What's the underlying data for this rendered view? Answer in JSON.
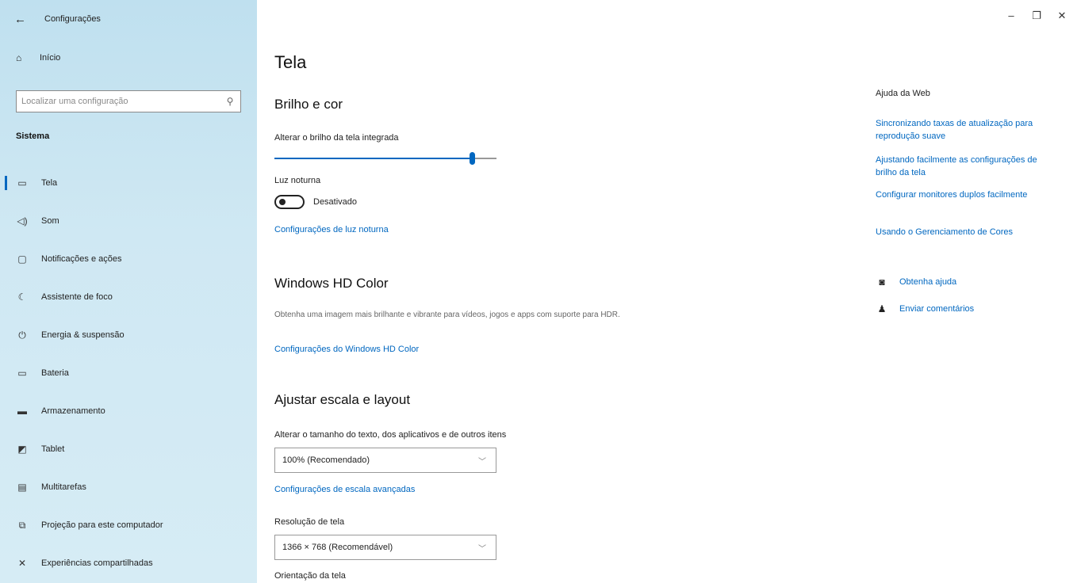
{
  "window": {
    "app_title": "Configurações",
    "back_icon": "back-arrow-icon",
    "controls": {
      "minimize": "–",
      "restore": "❐",
      "close": "✕"
    }
  },
  "sidebar": {
    "home_label": "Início",
    "search_placeholder": "Localizar uma configuração",
    "section": "Sistema",
    "items": [
      {
        "label": "Tela",
        "icon": "monitor-icon",
        "selected": true
      },
      {
        "label": "Som",
        "icon": "speaker-icon",
        "selected": false
      },
      {
        "label": "Notificações e ações",
        "icon": "notification-icon",
        "selected": false
      },
      {
        "label": "Assistente de foco",
        "icon": "moon-icon",
        "selected": false
      },
      {
        "label": "Energia & suspensão",
        "icon": "power-icon",
        "selected": false
      },
      {
        "label": "Bateria",
        "icon": "battery-icon",
        "selected": false
      },
      {
        "label": "Armazenamento",
        "icon": "storage-icon",
        "selected": false
      },
      {
        "label": "Tablet",
        "icon": "tablet-icon",
        "selected": false
      },
      {
        "label": "Multitarefas",
        "icon": "multitasking-icon",
        "selected": false
      },
      {
        "label": "Projeção para este computador",
        "icon": "projection-icon",
        "selected": false
      },
      {
        "label": "Experiências compartilhadas",
        "icon": "shared-icon",
        "selected": false
      }
    ]
  },
  "main": {
    "title": "Tela",
    "brightness": {
      "heading": "Brilho e cor",
      "slider_label": "Alterar o brilho da tela integrada",
      "value_fraction": 0.89,
      "night_light_label": "Luz noturna",
      "night_light_state": "Desativado",
      "night_light_link": "Configurações de luz noturna"
    },
    "hdr": {
      "heading": "Windows HD Color",
      "description": "Obtenha uma imagem mais brilhante e vibrante para vídeos, jogos e apps com suporte para HDR.",
      "link": "Configurações do Windows HD Color"
    },
    "scale": {
      "heading": "Ajustar escala e layout",
      "size_label": "Alterar o tamanho do texto, dos aplicativos e de outros itens",
      "size_value": "100% (Recomendado)",
      "advanced_link": "Configurações de escala avançadas",
      "resolution_label": "Resolução de tela",
      "resolution_value": "1366 × 768 (Recomendável)",
      "orientation_label": "Orientação da tela"
    }
  },
  "help": {
    "title": "Ajuda da Web",
    "links": [
      "Sincronizando taxas de atualização para reprodução suave",
      "Ajustando facilmente as configurações de brilho da tela",
      "Configurar monitores duplos facilmente",
      "Usando o Gerenciamento de Cores"
    ],
    "get_help": "Obtenha ajuda",
    "feedback": "Enviar comentários"
  },
  "colors": {
    "accent": "#0067c0",
    "sidebar_bg": "#cfe8f3"
  }
}
